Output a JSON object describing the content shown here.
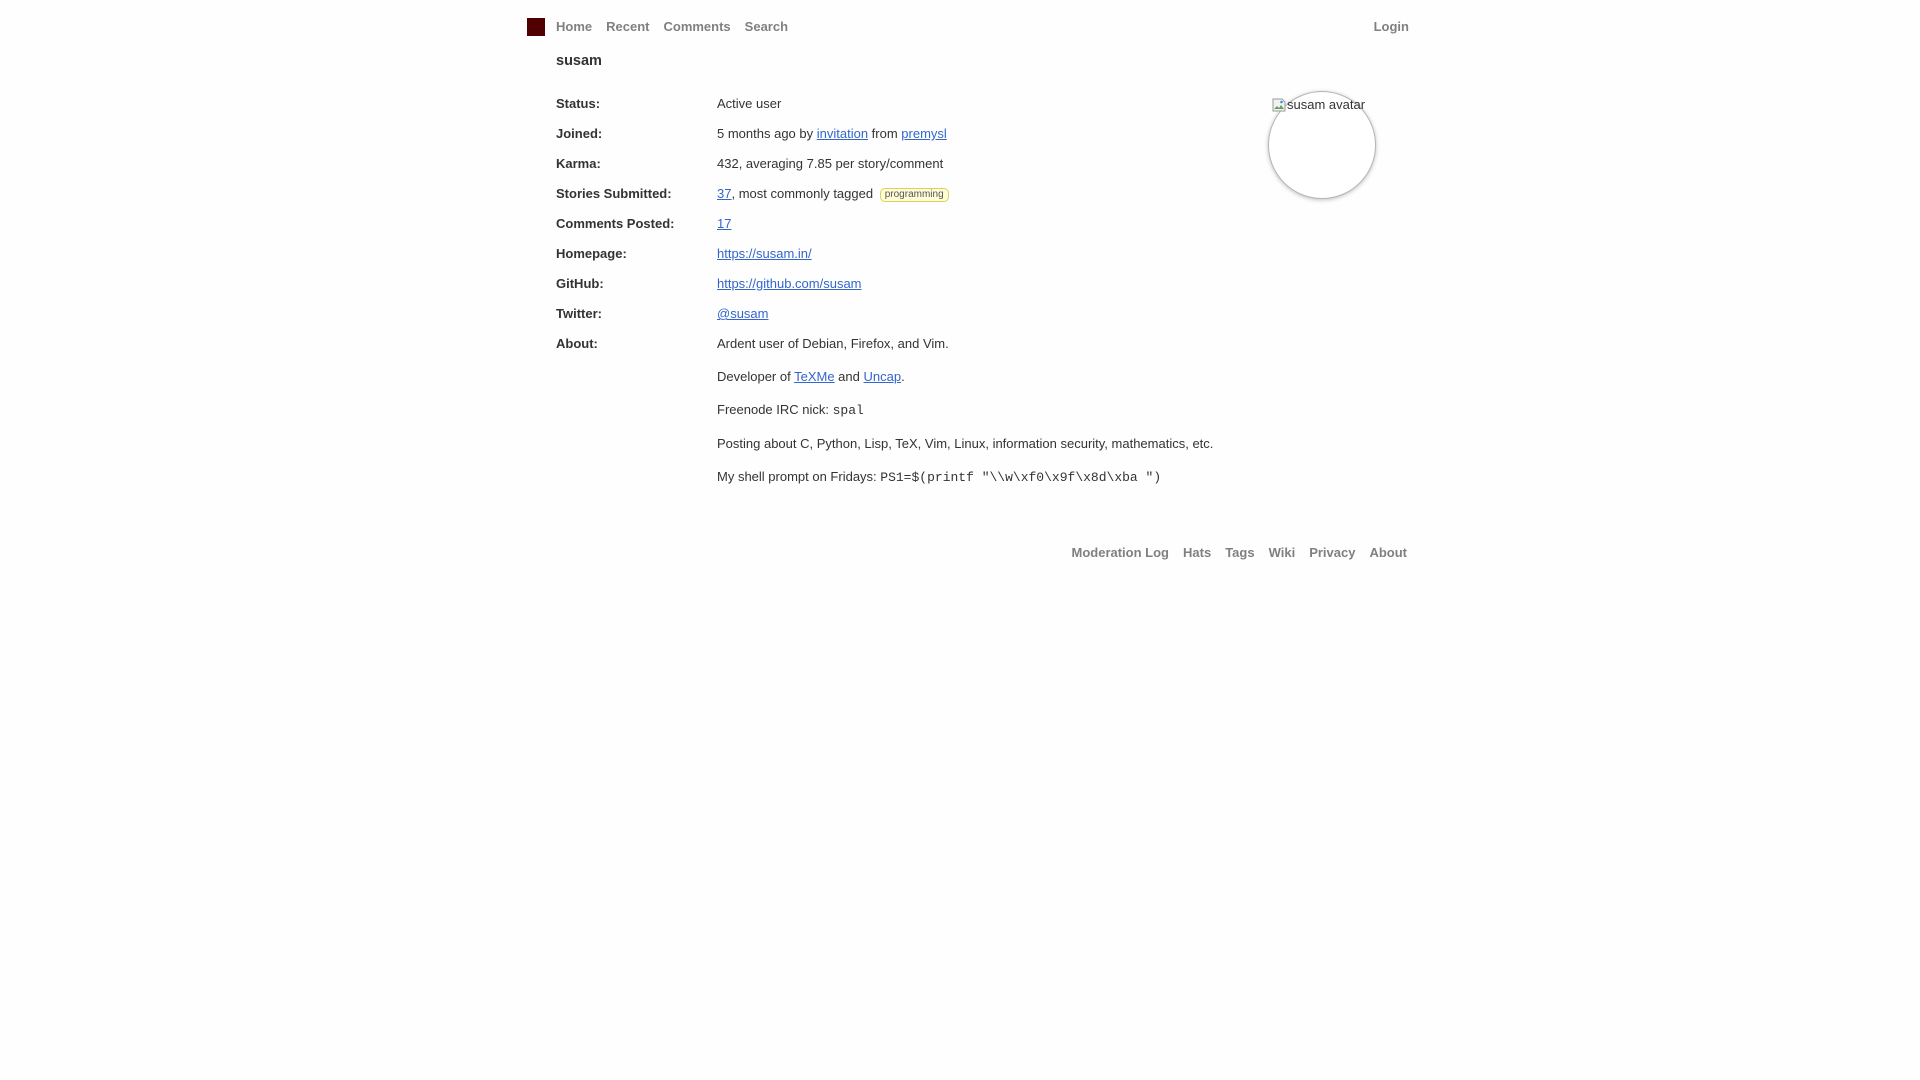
{
  "nav": {
    "logo_icon": "logo-square",
    "logo_color": "#500000",
    "items": [
      "Home",
      "Recent",
      "Comments",
      "Search"
    ],
    "login": "Login"
  },
  "user": {
    "username": "susam",
    "avatar_alt": "susam avatar"
  },
  "profile": {
    "status": {
      "label": "Status:",
      "value": "Active user"
    },
    "joined": {
      "label": "Joined:",
      "prefix": "5 months ago by ",
      "link1": "invitation",
      "middle": " from ",
      "link2": "premysl"
    },
    "karma": {
      "label": "Karma:",
      "value": "432, averaging 7.85 per story/comment"
    },
    "stories": {
      "label": "Stories Submitted:",
      "count": "37",
      "text": ", most commonly tagged",
      "tag": "programming"
    },
    "comments": {
      "label": "Comments Posted:",
      "count": "17"
    },
    "homepage": {
      "label": "Homepage:",
      "url": "https://susam.in/"
    },
    "github": {
      "label": "GitHub:",
      "url": "https://github.com/susam"
    },
    "twitter": {
      "label": "Twitter:",
      "handle": "@susam"
    },
    "about": {
      "label": "About:",
      "line1": "Ardent user of Debian, Firefox, and Vim.",
      "line2_prefix": "Developer of ",
      "line2_link1": "TeXMe",
      "line2_middle": " and ",
      "line2_link2": "Uncap",
      "line2_suffix": ".",
      "line3_prefix": "Freenode IRC nick: ",
      "line3_code": "spal",
      "line4": "Posting about C, Python, Lisp, TeX, Vim, Linux, information security, mathematics, etc.",
      "line5_prefix": "My shell prompt on Fridays: ",
      "line5_code": "PS1=$(printf \"\\\\w\\xf0\\x9f\\x8d\\xba \")"
    }
  },
  "footer": {
    "items": [
      "Moderation Log",
      "Hats",
      "Tags",
      "Wiki",
      "Privacy",
      "About"
    ]
  }
}
